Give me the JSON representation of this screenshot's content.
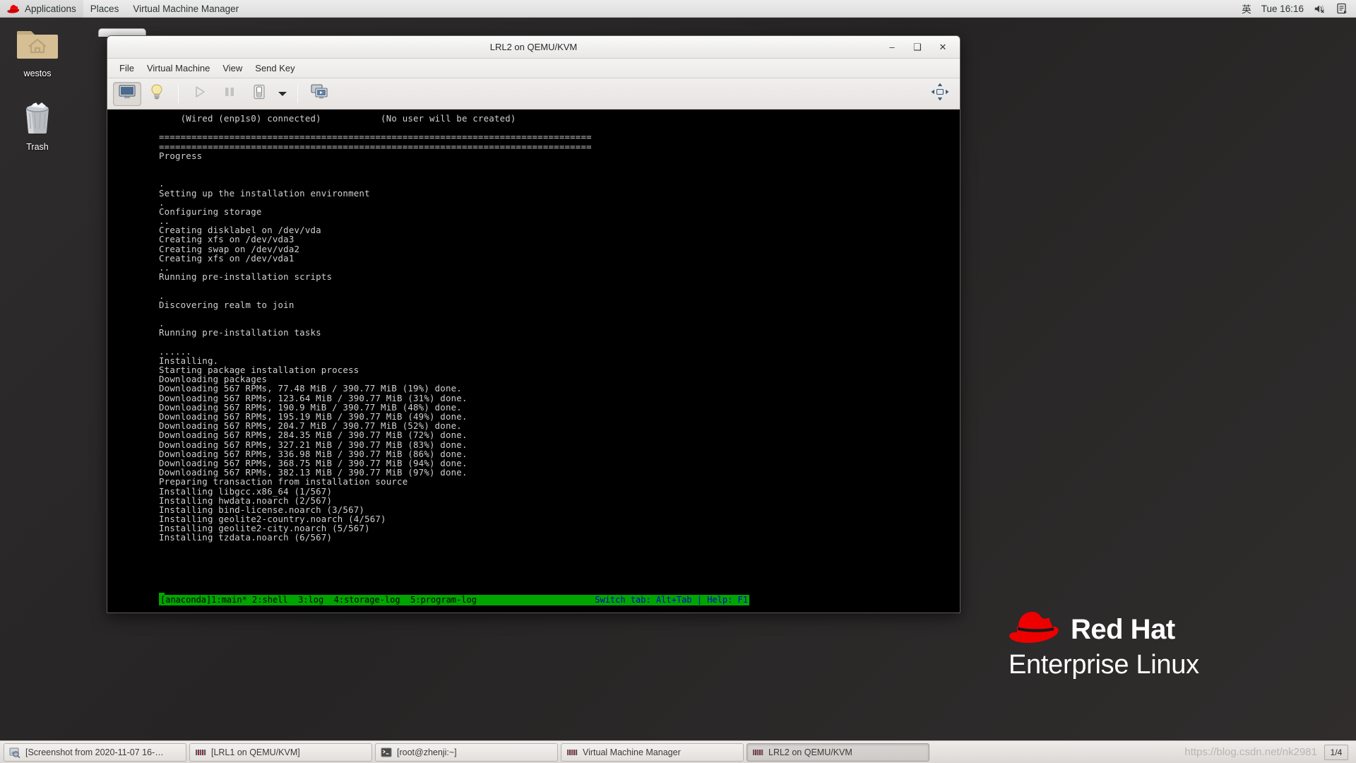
{
  "top_panel": {
    "applications": "Applications",
    "places": "Places",
    "active_app": "Virtual Machine Manager",
    "ime": "英",
    "clock": "Tue 16:16",
    "volume_icon": "volume-muted-icon",
    "notes_icon": "notes-icon",
    "logo_icon": "red-hat-logo-icon"
  },
  "desktop": {
    "icons": [
      {
        "label": "westos",
        "icon": "home-folder-icon"
      },
      {
        "label": "Trash",
        "icon": "trash-icon"
      }
    ]
  },
  "vm_window": {
    "title": "LRL2 on QEMU/KVM",
    "window_buttons": {
      "minimize": "–",
      "maximize": "❑",
      "close": "✕"
    },
    "menubar": [
      "File",
      "Virtual Machine",
      "View",
      "Send Key"
    ],
    "toolbar": [
      {
        "name": "console-view-button",
        "icon": "monitor-icon",
        "active": true
      },
      {
        "name": "details-view-button",
        "icon": "lightbulb-icon",
        "active": false
      },
      {
        "name": "run-button",
        "icon": "play-icon",
        "active": false
      },
      {
        "name": "pause-button",
        "icon": "pause-icon",
        "active": false
      },
      {
        "name": "shutdown-button",
        "icon": "power-switch-icon",
        "active": false
      },
      {
        "name": "shutdown-menu-button",
        "icon": "chevron-down-icon",
        "active": false
      },
      {
        "name": "snapshots-button",
        "icon": "screens-icon",
        "active": false
      },
      {
        "name": "fullscreen-button",
        "icon": "expand-arrows-icon",
        "active": false
      }
    ]
  },
  "console": {
    "lines": [
      {
        "text": "    (Wired (enp1s0) connected)           (No user will be created)"
      },
      {
        "text": ""
      },
      {
        "text": "================================================================================"
      },
      {
        "text": "================================================================================"
      },
      {
        "text": "Progress"
      },
      {
        "text": ""
      },
      {
        "text": ""
      },
      {
        "text": "."
      },
      {
        "text": "Setting up the installation environment"
      },
      {
        "text": "."
      },
      {
        "text": "Configuring storage"
      },
      {
        "text": ".."
      },
      {
        "text": "Creating disklabel on /dev/vda"
      },
      {
        "text": "Creating xfs on /dev/vda3"
      },
      {
        "text": "Creating swap on /dev/vda2"
      },
      {
        "text": "Creating xfs on /dev/vda1"
      },
      {
        "text": ".."
      },
      {
        "text": "Running pre-installation scripts"
      },
      {
        "text": ""
      },
      {
        "text": "."
      },
      {
        "text": "Discovering realm to join"
      },
      {
        "text": ""
      },
      {
        "text": "."
      },
      {
        "text": "Running pre-installation tasks"
      },
      {
        "text": ""
      },
      {
        "text": "......"
      },
      {
        "text": "Installing."
      },
      {
        "text": "Starting package installation process"
      },
      {
        "text": "Downloading packages"
      },
      {
        "text": "Downloading 567 RPMs, 77.48 MiB / 390.77 MiB (19%) done."
      },
      {
        "text": "Downloading 567 RPMs, 123.64 MiB / 390.77 MiB (31%) done."
      },
      {
        "text": "Downloading 567 RPMs, 190.9 MiB / 390.77 MiB (48%) done."
      },
      {
        "text": "Downloading 567 RPMs, 195.19 MiB / 390.77 MiB (49%) done."
      },
      {
        "text": "Downloading 567 RPMs, 204.7 MiB / 390.77 MiB (52%) done."
      },
      {
        "text": "Downloading 567 RPMs, 284.35 MiB / 390.77 MiB (72%) done."
      },
      {
        "text": "Downloading 567 RPMs, 327.21 MiB / 390.77 MiB (83%) done."
      },
      {
        "text": "Downloading 567 RPMs, 336.98 MiB / 390.77 MiB (86%) done."
      },
      {
        "text": "Downloading 567 RPMs, 368.75 MiB / 390.77 MiB (94%) done."
      },
      {
        "text": "Downloading 567 RPMs, 382.13 MiB / 390.77 MiB (97%) done."
      },
      {
        "text": "Preparing transaction from installation source"
      },
      {
        "text": "Installing libgcc.x86_64 (1/567)"
      },
      {
        "text": "Installing hwdata.noarch (2/567)"
      },
      {
        "text": "Installing bind-license.noarch (3/567)"
      },
      {
        "text": "Installing geolite2-country.noarch (4/567)"
      },
      {
        "text": "Installing geolite2-city.noarch (5/567)"
      },
      {
        "text": "Installing tzdata.noarch (6/567)"
      }
    ],
    "status_left": "[anaconda]1:main* 2:shell  3:log  4:storage-log  5:program-log",
    "status_right": "Switch tab: Alt+Tab | Help: F1",
    "status_bg_color": "#00a500",
    "status_fg_color": "#000000",
    "status_help_color": "#0000c8"
  },
  "branding": {
    "line1": "Red Hat",
    "line2": "Enterprise Linux",
    "hat_color": "#ee0000"
  },
  "taskbar": {
    "items": [
      {
        "label": "[Screenshot from 2020-11-07 16-…",
        "icon": "image-viewer-icon",
        "active": false
      },
      {
        "label": "[LRL1 on QEMU/KVM]",
        "icon": "virt-manager-icon",
        "active": false
      },
      {
        "label": "[root@zhenji:~]",
        "icon": "terminal-icon",
        "active": false
      },
      {
        "label": "Virtual Machine Manager",
        "icon": "virt-manager-icon",
        "active": false
      },
      {
        "label": "LRL2 on QEMU/KVM",
        "icon": "virt-manager-icon",
        "active": true
      }
    ],
    "watermark": "https://blog.csdn.net/nk2981",
    "workspace": "1/4"
  }
}
